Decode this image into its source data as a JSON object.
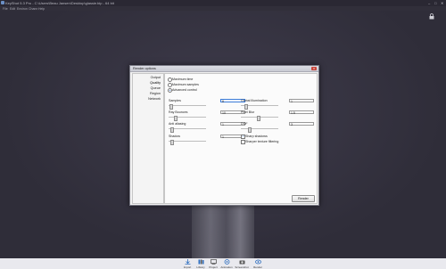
{
  "window": {
    "title": "KeyShot 5.3 Pro - C:\\Users\\Beau Jansen\\Desktop\\glassie.bip - 64 bit",
    "controls": {
      "minimize": "–",
      "maximize": "□",
      "close": "✕"
    }
  },
  "menubar": [
    "File",
    "Edit",
    "Environ",
    "Chann",
    "Help"
  ],
  "dialog": {
    "title": "Render options",
    "close_label": "x",
    "sidebar": [
      "Output",
      "Quality",
      "Queue",
      "Region",
      "Network"
    ],
    "selected_tab": "Quality",
    "modes": [
      {
        "label": "Maximum time",
        "selected": false
      },
      {
        "label": "Maximum samples",
        "selected": false
      },
      {
        "label": "Advanced control",
        "selected": true
      }
    ],
    "fields": {
      "samples": {
        "label": "Samples",
        "value": "8"
      },
      "global_illumination": {
        "label": "Global Illumination",
        "value": "1"
      },
      "ray_bounces": {
        "label": "Ray Bounces",
        "value": "10"
      },
      "pixel_blur": {
        "label": "Pixel Blur",
        "value": "1.5"
      },
      "anti_aliasing": {
        "label": "Anti aliasing",
        "value": "1"
      },
      "dof": {
        "label": "DOF",
        "value": "3"
      },
      "shadow": {
        "label": "Shadow",
        "value": "1"
      }
    },
    "checks": {
      "sharp_shadows": {
        "label": "Sharp shadows",
        "checked": true
      },
      "sharper_texture": {
        "label": "Sharper texture filtering",
        "checked": false
      }
    },
    "render_button": "Render"
  },
  "dock": [
    {
      "label": "Import",
      "icon": "import-icon"
    },
    {
      "label": "Library",
      "icon": "library-icon"
    },
    {
      "label": "Project",
      "icon": "project-icon"
    },
    {
      "label": "Animation",
      "icon": "animation-icon"
    },
    {
      "label": "Screenshot",
      "icon": "screenshot-icon"
    },
    {
      "label": "Render",
      "icon": "render-icon"
    }
  ],
  "colors": {
    "viewport": "#2e2c37",
    "accent": "#2a6ac8",
    "close": "#c8463c"
  }
}
